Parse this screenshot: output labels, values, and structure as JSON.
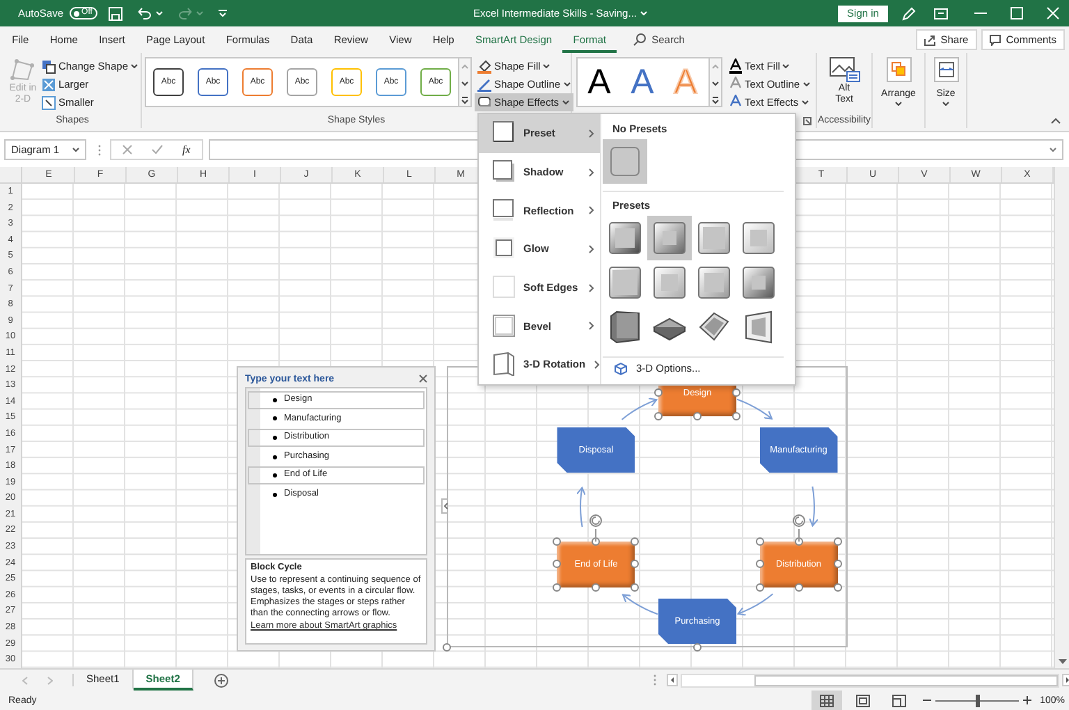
{
  "title_bar": {
    "autosave": {
      "label": "AutoSave",
      "on": false,
      "state_text": "Off"
    },
    "title": "Excel Intermediate Skills - Saving...",
    "sign_in": "Sign in"
  },
  "ribbon_tabs": [
    {
      "label": "File",
      "selected": false,
      "kind": "normal"
    },
    {
      "label": "Home",
      "selected": false,
      "kind": "normal"
    },
    {
      "label": "Insert",
      "selected": false,
      "kind": "normal"
    },
    {
      "label": "Page Layout",
      "selected": false,
      "kind": "normal"
    },
    {
      "label": "Formulas",
      "selected": false,
      "kind": "normal"
    },
    {
      "label": "Data",
      "selected": false,
      "kind": "normal"
    },
    {
      "label": "Review",
      "selected": false,
      "kind": "normal"
    },
    {
      "label": "View",
      "selected": false,
      "kind": "normal"
    },
    {
      "label": "Help",
      "selected": false,
      "kind": "normal"
    },
    {
      "label": "SmartArt Design",
      "selected": false,
      "kind": "contextual"
    },
    {
      "label": "Format",
      "selected": true,
      "kind": "contextual"
    }
  ],
  "search": {
    "placeholder": "Search"
  },
  "share": "Share",
  "comments": "Comments",
  "ribbon": {
    "shapes": {
      "label": "Shapes",
      "edit_2d": {
        "label": "Edit in 2-D",
        "disabled": true
      },
      "buttons": [
        {
          "label": "Change Shape",
          "dropdown": true
        },
        {
          "label": "Larger",
          "dropdown": false
        },
        {
          "label": "Smaller",
          "dropdown": false
        }
      ]
    },
    "shape_styles": {
      "label": "Shape Styles",
      "gallery": [
        {
          "text": "Abc",
          "color": "#404040"
        },
        {
          "text": "Abc",
          "color": "#4472c4"
        },
        {
          "text": "Abc",
          "color": "#ed7d31"
        },
        {
          "text": "Abc",
          "color": "#a5a5a5"
        },
        {
          "text": "Abc",
          "color": "#ffc000"
        },
        {
          "text": "Abc",
          "color": "#5b9bd5"
        },
        {
          "text": "Abc",
          "color": "#70ad47"
        }
      ]
    },
    "shape_format": [
      {
        "label": "Shape Fill",
        "expanded": false
      },
      {
        "label": "Shape Outline",
        "expanded": false
      },
      {
        "label": "Shape Effects",
        "expanded": true
      }
    ],
    "wordart": {
      "gallery": [
        {
          "text": "A",
          "color": "#000000",
          "kind": "fill"
        },
        {
          "text": "A",
          "color": "#4472c4",
          "kind": "fill"
        },
        {
          "text": "A",
          "color": "#ed7d31",
          "kind": "outline"
        }
      ],
      "buttons": [
        {
          "label": "Text Fill"
        },
        {
          "label": "Text Outline"
        },
        {
          "label": "Text Effects"
        }
      ]
    },
    "accessibility": {
      "label": "Accessibility",
      "button": "Alt Text"
    },
    "arrange": "Arrange",
    "size": "Size"
  },
  "formula_bar": {
    "name_box": "Diagram 1",
    "function_label": "fx"
  },
  "columns_left": [
    "E",
    "F",
    "G",
    "H",
    "I",
    "J",
    "K",
    "L",
    "M"
  ],
  "columns_right": [
    "T",
    "U",
    "V",
    "W",
    "X"
  ],
  "rows": [
    "1",
    "2",
    "3",
    "4",
    "5",
    "6",
    "7",
    "8",
    "9",
    "10",
    "11",
    "12",
    "13",
    "14",
    "15",
    "16",
    "17",
    "18",
    "19",
    "20",
    "21",
    "22",
    "23",
    "24",
    "25",
    "26",
    "27",
    "28",
    "29",
    "30"
  ],
  "effects_menu": {
    "items": [
      {
        "label": "Preset",
        "selected": true
      },
      {
        "label": "Shadow",
        "selected": false
      },
      {
        "label": "Reflection",
        "selected": false
      },
      {
        "label": "Glow",
        "selected": false
      },
      {
        "label": "Soft Edges",
        "selected": false
      },
      {
        "label": "Bevel",
        "selected": false
      },
      {
        "label": "3-D Rotation",
        "selected": false
      }
    ],
    "no_presets_title": "No Presets",
    "no_preset": {
      "selected": true
    },
    "presets_title": "Presets",
    "presets": [
      {
        "highlighted": false
      },
      {
        "highlighted": true
      },
      {
        "highlighted": false
      },
      {
        "highlighted": false
      },
      {
        "highlighted": false
      },
      {
        "highlighted": false
      },
      {
        "highlighted": false
      },
      {
        "highlighted": false
      },
      {
        "highlighted": false
      },
      {
        "highlighted": false
      },
      {
        "highlighted": false
      },
      {
        "highlighted": false
      }
    ],
    "options": "3-D Options..."
  },
  "text_pane": {
    "title": "Type your text here",
    "items": [
      {
        "text": "Design",
        "selected": true
      },
      {
        "text": "Manufacturing",
        "selected": false
      },
      {
        "text": "Distribution",
        "selected": true
      },
      {
        "text": "Purchasing",
        "selected": false
      },
      {
        "text": "End of Life",
        "selected": true
      },
      {
        "text": "Disposal",
        "selected": false
      }
    ],
    "description": {
      "title": "Block Cycle",
      "body": "Use to represent a continuing sequence of stages, tasks, or events in a circular flow. Emphasizes the stages or steps rather than the connecting arrows or flow.",
      "link": "Learn more about SmartArt graphics"
    }
  },
  "diagram": {
    "nodes": [
      {
        "text": "Design",
        "kind": "bevel",
        "color": "#ed7d31",
        "selected": true
      },
      {
        "text": "Manufacturing",
        "kind": "snip",
        "color": "#4472c4",
        "selected": false
      },
      {
        "text": "Distribution",
        "kind": "bevel",
        "color": "#ed7d31",
        "selected": true
      },
      {
        "text": "Purchasing",
        "kind": "snip",
        "color": "#4472c4",
        "selected": false
      },
      {
        "text": "End of Life",
        "kind": "bevel",
        "color": "#ed7d31",
        "selected": true
      },
      {
        "text": "Disposal",
        "kind": "snip",
        "color": "#4472c4",
        "selected": false
      }
    ]
  },
  "sheet_tabs": [
    {
      "label": "Sheet1",
      "selected": false
    },
    {
      "label": "Sheet2",
      "selected": true
    }
  ],
  "status_bar": {
    "status": "Ready",
    "views": [
      {
        "kind": "normal",
        "selected": true
      },
      {
        "kind": "page_layout",
        "selected": false
      },
      {
        "kind": "page_break",
        "selected": false
      }
    ],
    "zoom": {
      "level": 0.5,
      "reading": "100%"
    }
  }
}
